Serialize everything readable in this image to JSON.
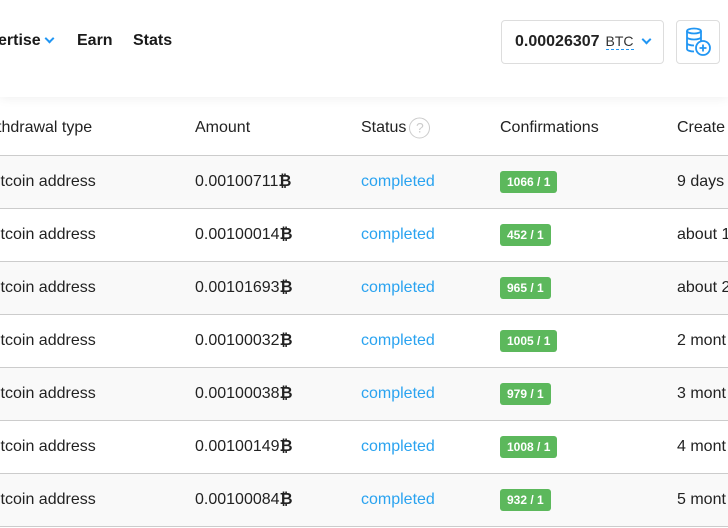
{
  "nav": {
    "advertise": "ertise",
    "earn": "Earn",
    "stats": "Stats"
  },
  "balance": {
    "value": "0.00026307",
    "currency": "BTC"
  },
  "deposit_icon": "coins-plus-icon",
  "colors": {
    "accent": "#2196f3",
    "status": "#2aa3f0",
    "badge": "#5cb85c"
  },
  "table": {
    "headers": [
      "thdrawal type",
      "Amount",
      "Status",
      "Confirmations",
      "Create"
    ],
    "status_help": "?",
    "currency_symbol": "₿",
    "rows": [
      {
        "type": "itcoin address",
        "amount": "0.00100711",
        "status": "completed",
        "conf": "1066 / 1",
        "created": "9 days"
      },
      {
        "type": "itcoin address",
        "amount": "0.00100014",
        "status": "completed",
        "conf": "452 / 1",
        "created": "about 1"
      },
      {
        "type": "itcoin address",
        "amount": "0.00101693",
        "status": "completed",
        "conf": "965 / 1",
        "created": "about 2"
      },
      {
        "type": "itcoin address",
        "amount": "0.00100032",
        "status": "completed",
        "conf": "1005 / 1",
        "created": "2 mont"
      },
      {
        "type": "itcoin address",
        "amount": "0.00100038",
        "status": "completed",
        "conf": "979 / 1",
        "created": "3 mont"
      },
      {
        "type": "itcoin address",
        "amount": "0.00100149",
        "status": "completed",
        "conf": "1008 / 1",
        "created": "4 mont"
      },
      {
        "type": "itcoin address",
        "amount": "0.00100084",
        "status": "completed",
        "conf": "932 / 1",
        "created": "5 mont"
      }
    ]
  }
}
